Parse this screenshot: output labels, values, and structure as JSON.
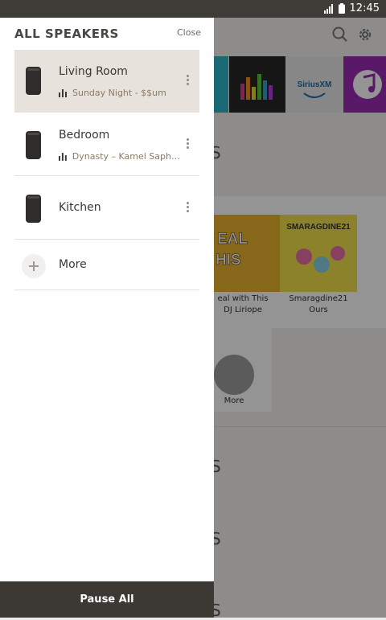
{
  "status_bar": {
    "time": "12:45"
  },
  "drawer": {
    "title": "ALL SPEAKERS",
    "close_label": "Close",
    "speakers": [
      {
        "name": "Living Room",
        "now_playing": "Sunday Night - $$um",
        "active": true
      },
      {
        "name": "Bedroom",
        "now_playing": "Dynasty – Kamel Sapha…",
        "active": false
      },
      {
        "name": "Kitchen",
        "now_playing": "",
        "active": false
      }
    ],
    "more_label": "More",
    "pause_all_label": "Pause All"
  },
  "background": {
    "sections": [
      "S",
      "S",
      "S",
      "S",
      "S"
    ],
    "tiles": [
      {
        "name": "tile-unknown",
        "color": "#2bb3c8"
      },
      {
        "name": "tile-deezer",
        "color": "#262626"
      },
      {
        "name": "tile-siriusxm",
        "color": "#e9e9e9",
        "label": "SiriusXM"
      },
      {
        "name": "tile-music",
        "color": "#9b2cb3"
      }
    ],
    "albums": [
      {
        "title": "eal with This",
        "artist": "DJ Liriope"
      },
      {
        "title": "Smaragdine21",
        "artist": "Ours"
      }
    ],
    "more_label": "More"
  }
}
